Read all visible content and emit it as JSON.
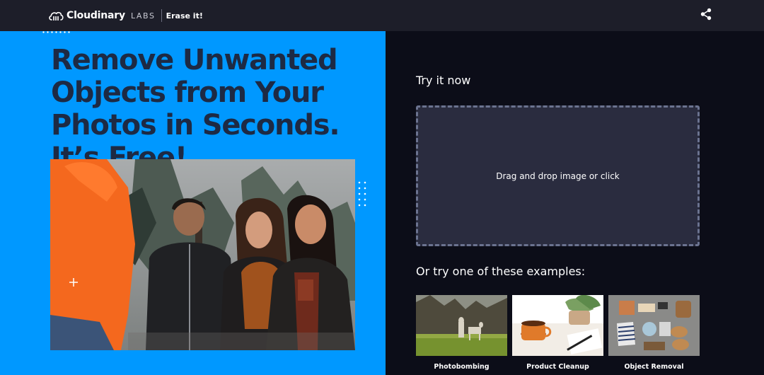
{
  "header": {
    "brand_name": "Cloudinary",
    "brand_labs": "LABS",
    "product_name": "Erase it!",
    "logo_icon": "cloud-logo-icon",
    "share_icon": "share-icon"
  },
  "hero": {
    "headline_lines": [
      "Remove Unwanted",
      "Objects from Your",
      "Photos in Seconds.",
      "It’s Free!"
    ],
    "background_color": "#0098ff",
    "headline_color": "#1d2a44",
    "photo_icon": "people-laughing-photo"
  },
  "panel": {
    "try_title": "Try it now",
    "dropzone_text": "Drag and drop image or click",
    "examples_title": "Or try one of these examples:",
    "examples": [
      {
        "label": "Photobombing"
      },
      {
        "label": "Product Cleanup"
      },
      {
        "label": "Object Removal"
      }
    ]
  }
}
